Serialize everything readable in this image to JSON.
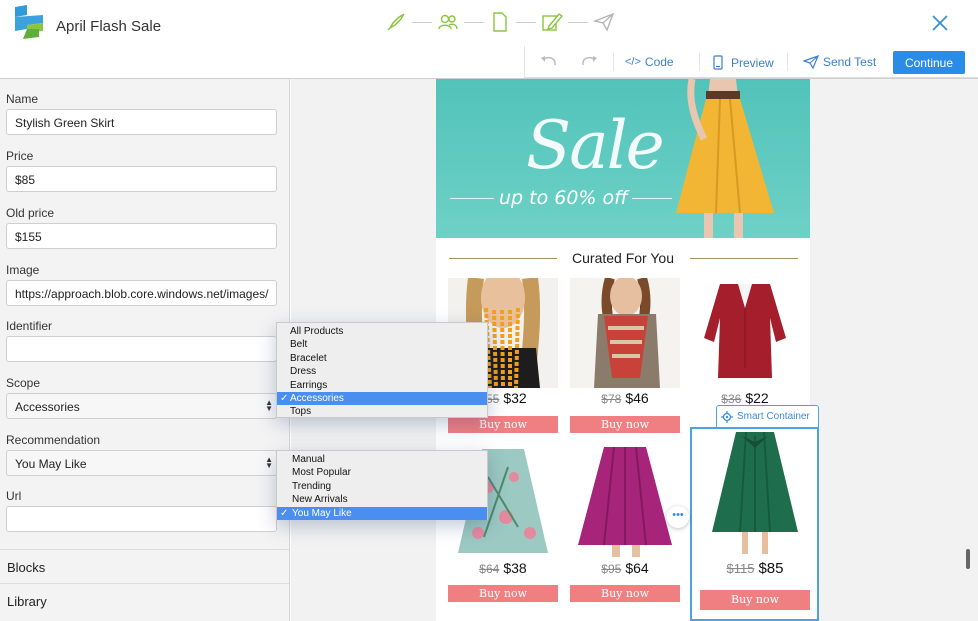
{
  "header": {
    "title": "April Flash Sale",
    "steps": [
      "rocket-icon",
      "audience-icon",
      "document-icon",
      "design-pen-icon",
      "send-plane-icon"
    ],
    "accent": "#8cc63f"
  },
  "toolbar": {
    "code_label": "Code",
    "code_glyph": "</>",
    "preview_label": "Preview",
    "send_test_label": "Send Test",
    "continue_label": "Continue",
    "accent": "#2a8ce6"
  },
  "form": {
    "name_label": "Name",
    "name_value": "Stylish Green Skirt",
    "price_label": "Price",
    "price_value": "$85",
    "old_price_label": "Old price",
    "old_price_value": "$155",
    "image_label": "Image",
    "image_value": "https://approach.blob.core.windows.net/images/",
    "identifier_label": "Identifier",
    "identifier_value": "",
    "scope_label": "Scope",
    "scope_value": "Accessories",
    "recommendation_label": "Recommendation",
    "recommendation_value": "You May Like",
    "url_label": "Url",
    "url_value": ""
  },
  "sections": {
    "blocks": "Blocks",
    "library": "Library"
  },
  "scope_menu": {
    "options": [
      "All Products",
      "Belt",
      "Bracelet",
      "Dress",
      "Earrings",
      "Accessories",
      "Tops"
    ],
    "selected": "Accessories",
    "check": "✓"
  },
  "recommendation_menu": {
    "options": [
      "Manual",
      "Most Popular",
      "Trending",
      "New Arrivals",
      "You May Like"
    ],
    "selected": "You May Like",
    "check": "✓"
  },
  "email": {
    "hero_title": "Sale",
    "hero_subtitle": "up to 60% off",
    "section_title": "Curated For You",
    "buy_label": "Buy now",
    "smart_container_label": "Smart Container",
    "more_glyph": "•••",
    "products": [
      {
        "old": "$55",
        "price": "$32"
      },
      {
        "old": "$78",
        "price": "$46"
      },
      {
        "old": "$36",
        "price": "$22"
      },
      {
        "old": "$64",
        "price": "$38"
      },
      {
        "old": "$95",
        "price": "$64"
      },
      {
        "old": "$115",
        "price": "$85"
      }
    ]
  }
}
